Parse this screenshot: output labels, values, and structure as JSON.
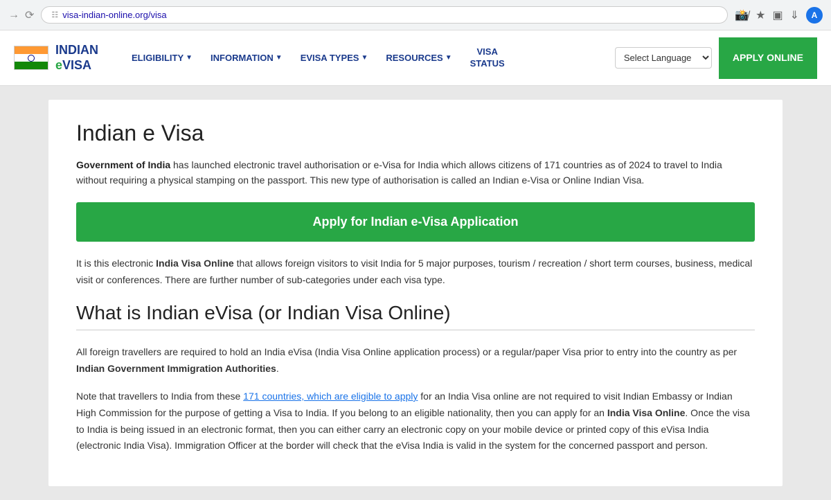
{
  "browser": {
    "url": "visa-indian-online.org/visa",
    "profile_initial": "A"
  },
  "header": {
    "logo_indian": "INDIAN",
    "logo_evisa": "eVISA",
    "nav": [
      {
        "label": "ELIGIBILITY",
        "has_dropdown": true
      },
      {
        "label": "INFORMATION",
        "has_dropdown": true
      },
      {
        "label": "eVISA TYPES",
        "has_dropdown": true
      },
      {
        "label": "RESOURCES",
        "has_dropdown": true
      },
      {
        "label": "VISA\nSTATUS",
        "has_dropdown": false
      }
    ],
    "lang_select_label": "Select Language",
    "apply_line1": "APPLY",
    "apply_line2": "ONLINE"
  },
  "main": {
    "title": "Indian e Visa",
    "intro": {
      "bold": "Government of India",
      "text": " has launched electronic travel authorisation or e-Visa for India which allows citizens of 171 countries as of 2024 to travel to India without requiring a physical stamping on the passport. This new type of authorisation is called an Indian e-Visa or Online Indian Visa."
    },
    "apply_cta": "Apply for Indian e-Visa Application",
    "body1_prefix": "It is this electronic ",
    "body1_bold": "India Visa Online",
    "body1_text": " that allows foreign visitors to visit India for 5 major purposes, tourism / recreation / short term courses, business, medical visit or conferences. There are further number of sub-categories under each visa type.",
    "section_title": "What is Indian eVisa (or Indian Visa Online)",
    "section_para1_prefix": "All foreign travellers are required to hold an India eVisa (India Visa Online application process) or a regular/paper Visa prior to entry into the country as per ",
    "section_para1_bold": "Indian Government Immigration Authorities",
    "section_para1_suffix": ".",
    "section_para2_prefix": "Note that travellers to India from these ",
    "section_para2_link": "171 countries, which are eligible to apply",
    "section_para2_mid": " for an India Visa online are not required to visit Indian Embassy or Indian High Commission for the purpose of getting a Visa to India. If you belong to an eligible nationality, then you can apply for an ",
    "section_para2_bold": "India Visa Online",
    "section_para2_end": ". Once the visa to India is being issued in an electronic format, then you can either carry an electronic copy on your mobile device or printed copy of this eVisa India (electronic India Visa). Immigration Officer at the border will check that the eVisa India is valid in the system for the concerned passport and person."
  }
}
